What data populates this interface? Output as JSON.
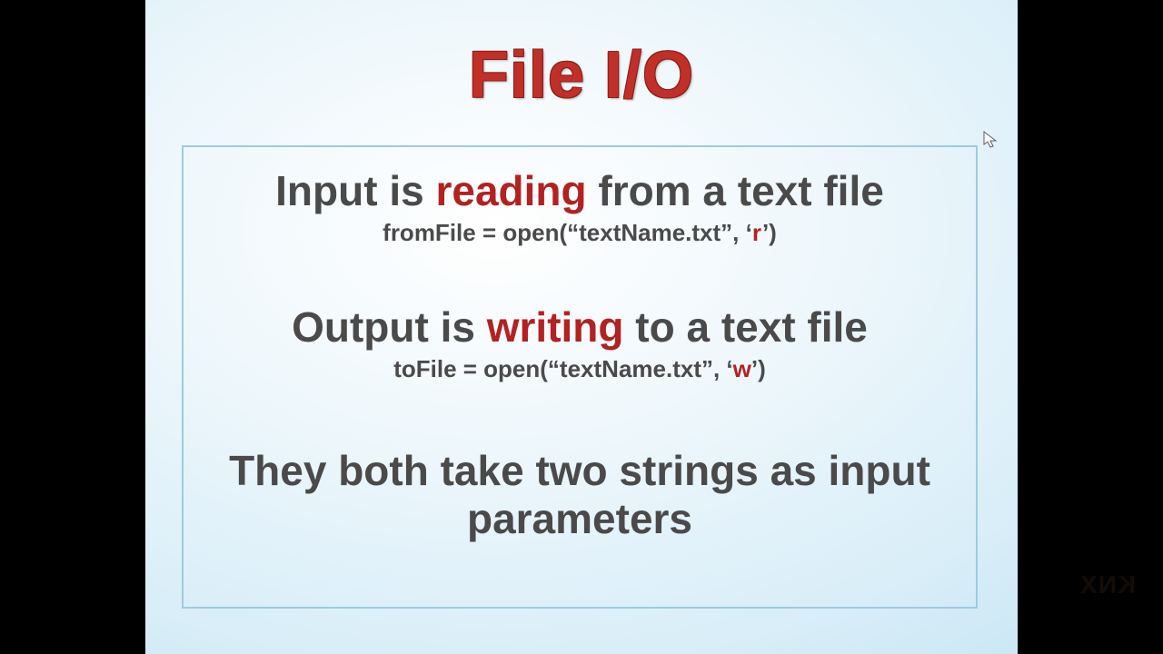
{
  "title": "File I/O",
  "section1": {
    "pre": "Input is ",
    "hi": "reading",
    "post": " from a text file",
    "code_pre": "fromFile = open(“textName.txt”, ‘",
    "code_hi": "r",
    "code_post": "’)"
  },
  "section2": {
    "pre": "Output is ",
    "hi": "writing",
    "post": " to a text file",
    "code_pre": "toFile = open(“textName.txt”, ‘",
    "code_hi": "w",
    "code_post": "’)"
  },
  "footer": "They both take two strings as input parameters",
  "watermark": "KNX"
}
